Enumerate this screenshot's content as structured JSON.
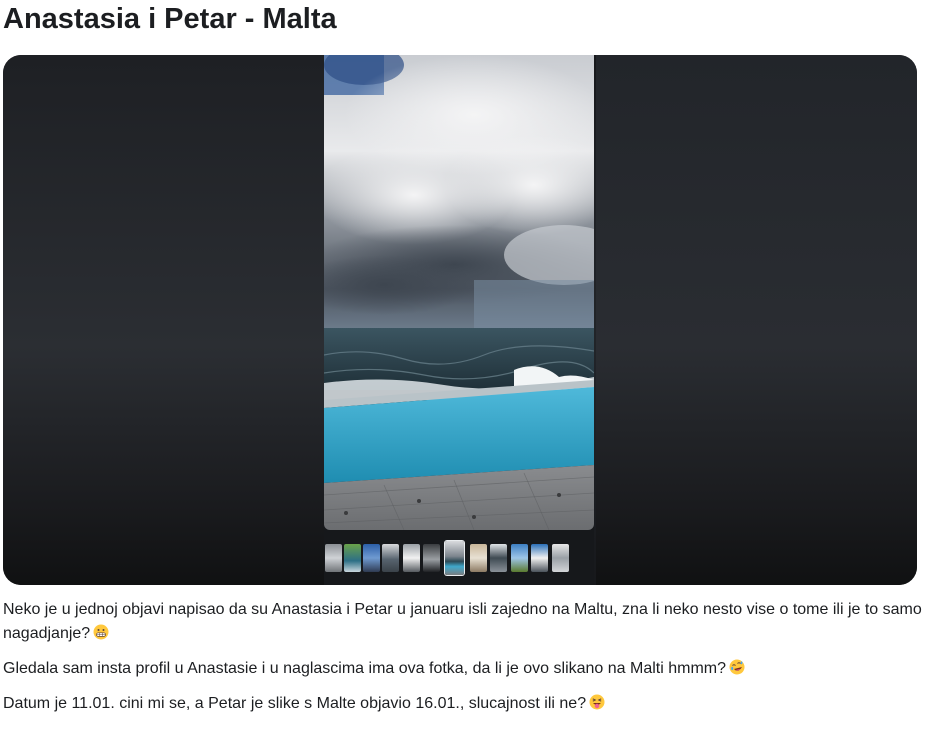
{
  "post": {
    "title": "Anastasia i Petar - Malta",
    "paragraphs": [
      {
        "text": "Neko je u jednoj objavi napisao da su Anastasia i Petar u januaru isli zajedno na Maltu, zna li neko nesto vise o tome ili je to samo nagadjanje?",
        "emoji": "grimacing-face-emoji"
      },
      {
        "text": "Gledala sam insta profil u Anastasie i u naglascima ima ova fotka, da li je ovo slikano na Malti hmmm?",
        "emoji": "rolling-on-floor-laughing-emoji"
      },
      {
        "text": "Datum je 11.01. cini mi se, a Petar je slike s Malte objavio 16.01., slucajnost ili ne?",
        "emoji": "squinting-face-with-tongue-emoji"
      }
    ]
  },
  "media": {
    "photo_subject": "infinity pool overlooking stormy sea",
    "thumbnail_count": 12,
    "active_thumbnail_index": 6
  },
  "colors": {
    "text": "#1c1e21",
    "media_background": "#1b1d21",
    "pool": "#2aa3c7",
    "sea": "#2f4650"
  }
}
